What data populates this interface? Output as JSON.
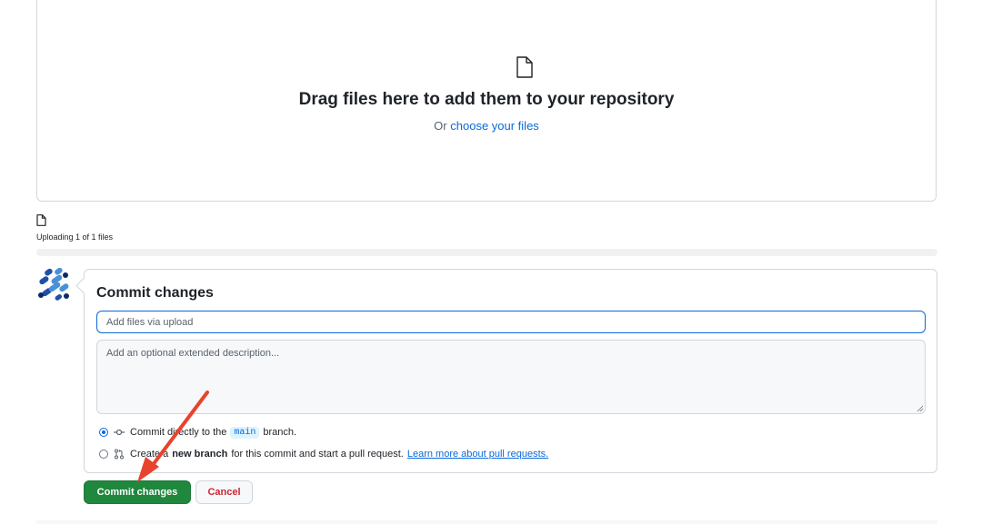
{
  "dropzone": {
    "icon": "file-icon",
    "title": "Drag files here to add them to your repository",
    "or_text": "Or",
    "choose_link": "choose your files"
  },
  "upload_status": {
    "icon": "file-icon",
    "text": "Uploading 1 of 1 files",
    "progress": 1.0
  },
  "commit": {
    "avatar": "identicon-avatar",
    "title": "Commit changes",
    "summary_placeholder": "Add files via upload",
    "description_placeholder": "Add an optional extended description...",
    "option_direct": {
      "checked": true,
      "icon": "git-commit-icon",
      "prefix": "Commit directly to the",
      "branch": "main",
      "suffix": "branch."
    },
    "option_new_branch": {
      "checked": false,
      "icon": "git-pull-request-icon",
      "prefix": "Create a",
      "bold": "new branch",
      "suffix": "for this commit and start a pull request.",
      "link": "Learn more about pull requests."
    }
  },
  "buttons": {
    "commit_label": "Commit changes",
    "cancel_label": "Cancel"
  },
  "annotation": {
    "type": "red-arrow",
    "color": "#e8432d"
  },
  "colors": {
    "primary_button": "#1f883d",
    "link": "#0969da",
    "danger": "#d1242f"
  }
}
